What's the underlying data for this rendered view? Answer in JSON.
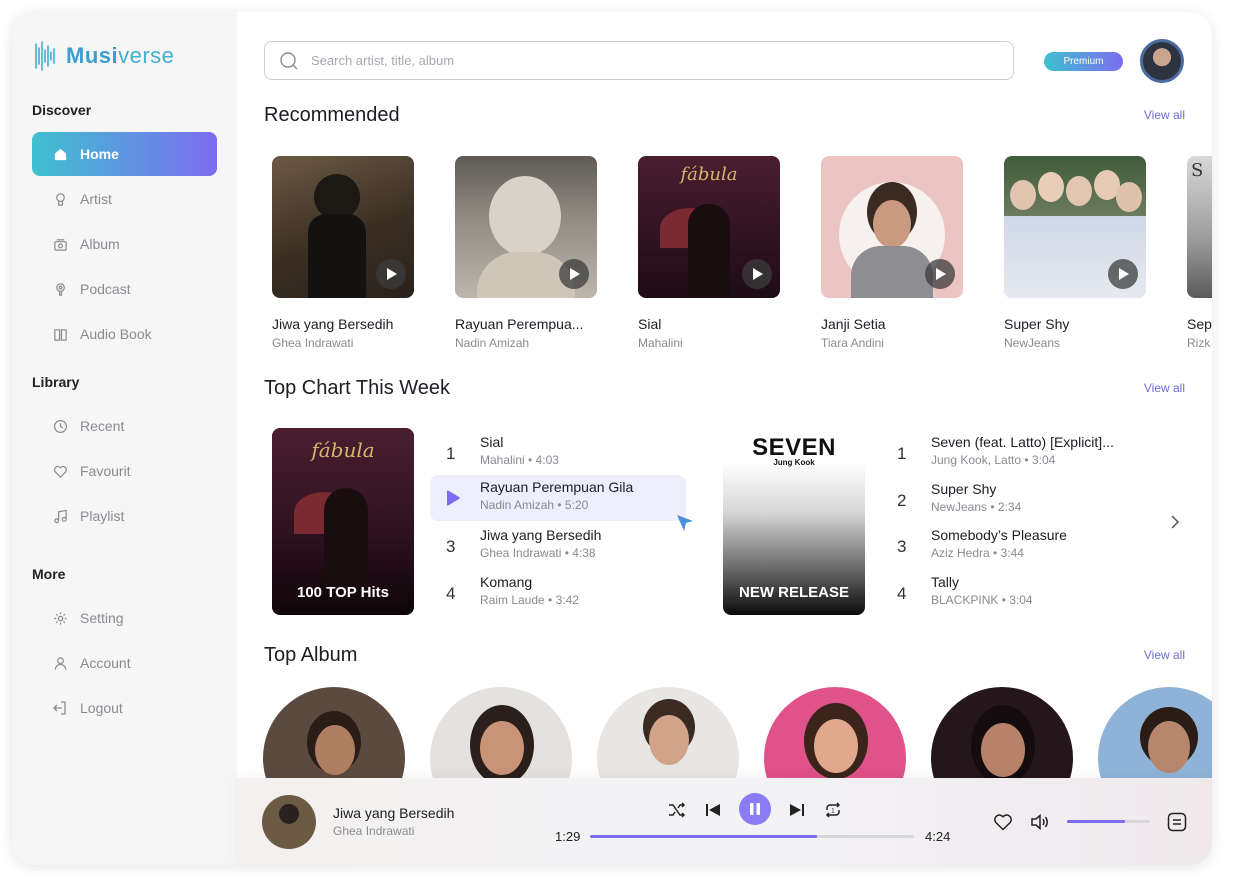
{
  "app": {
    "name_part1": "Musi",
    "name_part2": "verse"
  },
  "sidebar": {
    "discover_label": "Discover",
    "discover_items": [
      {
        "label": "Home",
        "icon": "home-icon",
        "active": true
      },
      {
        "label": "Artist",
        "icon": "artist-icon"
      },
      {
        "label": "Album",
        "icon": "album-icon"
      },
      {
        "label": "Podcast",
        "icon": "podcast-icon"
      },
      {
        "label": "Audio Book",
        "icon": "audiobook-icon"
      }
    ],
    "library_label": "Library",
    "library_items": [
      {
        "label": "Recent",
        "icon": "clock-icon"
      },
      {
        "label": "Favourit",
        "icon": "heart-icon"
      },
      {
        "label": "Playlist",
        "icon": "music-note-icon"
      }
    ],
    "more_label": "More",
    "more_items": [
      {
        "label": "Setting",
        "icon": "gear-icon"
      },
      {
        "label": "Account",
        "icon": "user-icon"
      },
      {
        "label": "Logout",
        "icon": "logout-icon"
      }
    ]
  },
  "header": {
    "search_placeholder": "Search artist, title, album",
    "premium_label": "Premium"
  },
  "recommended": {
    "title": "Recommended",
    "view_all": "View all",
    "items": [
      {
        "title": "Jiwa yang Bersedih",
        "artist": "Ghea Indrawati"
      },
      {
        "title": "Rayuan Perempua...",
        "artist": "Nadin Amizah"
      },
      {
        "title": "Sial",
        "artist": "Mahalini"
      },
      {
        "title": "Janji Setia",
        "artist": "Tiara Andini"
      },
      {
        "title": "Super Shy",
        "artist": "NewJeans"
      },
      {
        "title": "Sep",
        "artist": "Rizk"
      }
    ]
  },
  "top_chart": {
    "title": "Top Chart This Week",
    "view_all": "View  all",
    "playlist1": {
      "label": "100 TOP Hits",
      "cover_title": "fábula",
      "tracks": [
        {
          "num": "1",
          "title": "Sial",
          "sub": "Mahalini • 4:03"
        },
        {
          "num": "",
          "title": "Rayuan Perempuan Gila",
          "sub": "Nadin Amizah • 5:20"
        },
        {
          "num": "3",
          "title": "Jiwa yang Bersedih",
          "sub": "Ghea Indrawati • 4:38"
        },
        {
          "num": "4",
          "title": "Komang",
          "sub": "Raim Laude • 3:42"
        }
      ]
    },
    "playlist2": {
      "label": "NEW RELEASE",
      "cover_title": "SEVEN",
      "cover_sub": "Jung Kook",
      "tracks": [
        {
          "num": "1",
          "title": "Seven (feat. Latto) [Explicit]...",
          "sub": "Jung Kook, Latto • 3:04"
        },
        {
          "num": "2",
          "title": "Super Shy",
          "sub": "NewJeans • 2:34"
        },
        {
          "num": "3",
          "title": "Somebody’s Pleasure",
          "sub": "Aziz Hedra • 3:44"
        },
        {
          "num": "4",
          "title": "Tally",
          "sub": "BLACKPINK • 3:04"
        }
      ]
    }
  },
  "top_album": {
    "title": "Top Album",
    "view_all": "View all"
  },
  "player": {
    "title": "Jiwa yang Bersedih",
    "artist": "Ghea Indrawati",
    "elapsed": "1:29",
    "duration": "4:24",
    "progress": 0.7,
    "volume": 0.7
  },
  "colors": {
    "accent_start": "#3ec1cf",
    "accent_end": "#7c6cf0",
    "link": "#6e6cd6"
  }
}
